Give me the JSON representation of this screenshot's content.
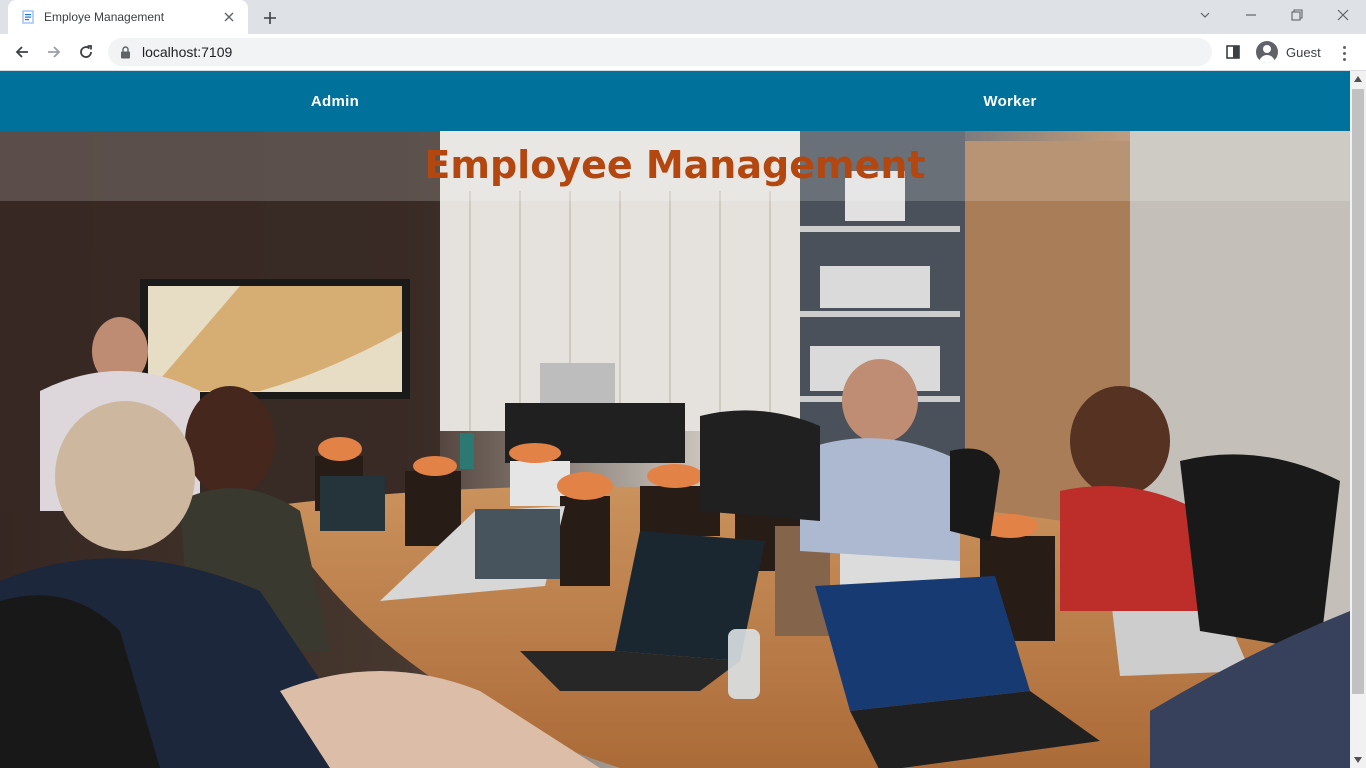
{
  "browser": {
    "tab": {
      "title": "Employe Management",
      "favicon": "document-icon"
    },
    "url": "localhost:7109",
    "profile": {
      "name": "Guest"
    },
    "icons": [
      "back-icon",
      "forward-icon",
      "reload-icon",
      "lock-icon",
      "side-panel-icon",
      "menu-icon"
    ]
  },
  "site": {
    "nav": [
      {
        "label": "Admin"
      },
      {
        "label": "Worker"
      }
    ],
    "hero": {
      "title": "Employee Management",
      "image": "meeting-room-photo"
    }
  },
  "colors": {
    "nav_bg": "#00719a",
    "title": "#b3470f",
    "tabstrip": "#dee1e6"
  }
}
